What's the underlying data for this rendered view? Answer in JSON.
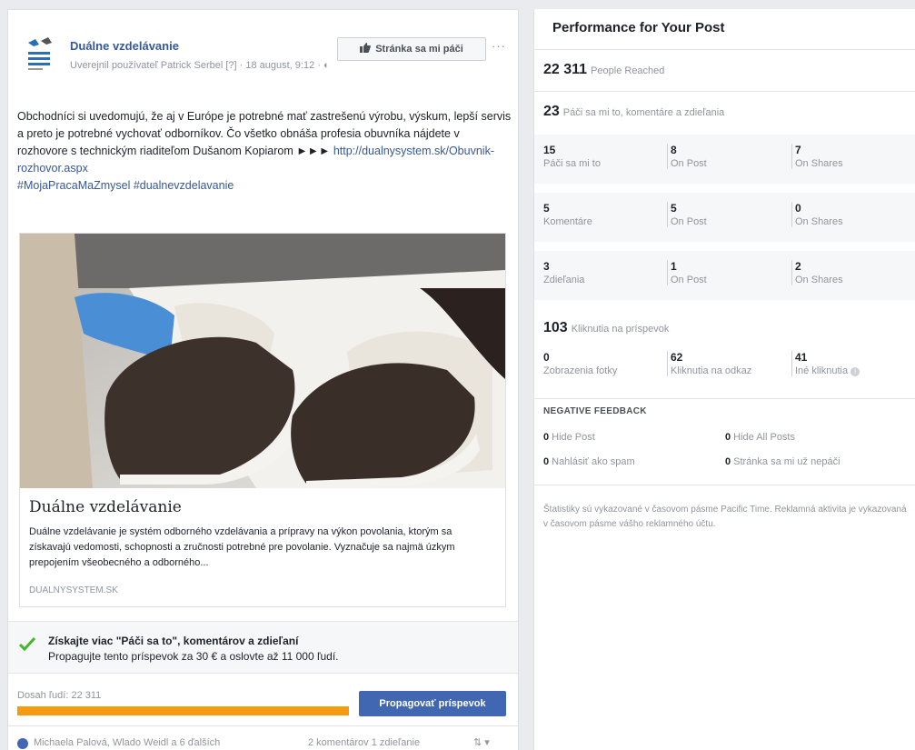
{
  "post": {
    "page_name": "Duálne vzdelávanie",
    "meta": "Uverejnil používateľ Patrick Serbel [?] · 18 august, 9:12 · ",
    "like_page_label": "Stránka sa mi páči",
    "more_label": "···",
    "text_main": "Obchodníci si uvedomujú, že aj v Európe je potrebné mať zastrešenú výrobu, výskum, lepší servis a preto je potrebné vychovať odborníkov. Čo všetko obnáša profesia obuvníka nájdete v rozhovore s technickým riaditeľom Dušanom Kopiarom ►►► ",
    "text_link": "http://dualnysystem.sk/Obuvnik-rozhovor.aspx",
    "hashtags": "#MojaPracaMaZmysel #dualnevzdelavanie",
    "attachment": {
      "title": "Duálne vzdelávanie",
      "description": "Duálne vzdelávanie je systém odborného vzdelávania a prípravy na výkon povolania, ktorým sa získavajú vedomosti, schopnosti a zručnosti potrebné pre povolanie. Vyznačuje sa najmä úzkym prepojením všeobecného a odborného...",
      "domain": "DUALNYSYSTEM.SK"
    },
    "promo": {
      "title": "Získajte viac \"Páči sa to\", komentárov a zdieľaní",
      "text": "Propagujte tento príspevok za 30 € a oslovte až 11 000 ľudí."
    },
    "reach": {
      "label": "Dosah ľudí: 22 311",
      "progress_fraction": 1.0,
      "bar_color": "#f39c12",
      "boost_label": "Propagovať príspevok"
    },
    "footer": {
      "names": "Michaela Palová, Wlado Weidl a 6 ďalších",
      "counts": "2 komentárov  1 zdieľanie",
      "sort": "⇅ ▾"
    }
  },
  "performance": {
    "title": "Performance for Your Post",
    "reached": {
      "value": "22 311",
      "label": "People Reached"
    },
    "engagement": {
      "value": "23",
      "label": "Páči sa mi to, komentáre a zdieľania"
    },
    "rows": [
      [
        {
          "value": "15",
          "label": "Páči sa mi to"
        },
        {
          "value": "8",
          "label": "On Post"
        },
        {
          "value": "7",
          "label": "On Shares"
        }
      ],
      [
        {
          "value": "5",
          "label": "Komentáre"
        },
        {
          "value": "5",
          "label": "On Post"
        },
        {
          "value": "0",
          "label": "On Shares"
        }
      ],
      [
        {
          "value": "3",
          "label": "Zdieľania"
        },
        {
          "value": "1",
          "label": "On Post"
        },
        {
          "value": "2",
          "label": "On Shares"
        }
      ]
    ],
    "clicks": {
      "value": "103",
      "label": "Kliknutia na príspevok"
    },
    "click_breakdown": [
      {
        "value": "0",
        "label": "Zobrazenia fotky"
      },
      {
        "value": "62",
        "label": "Kliknutia na odkaz"
      },
      {
        "value": "41",
        "label": "Iné kliknutia"
      }
    ],
    "negative_title": "NEGATIVE FEEDBACK",
    "negative": [
      {
        "value": "0",
        "label": "Hide Post"
      },
      {
        "value": "0",
        "label": "Hide All Posts"
      },
      {
        "value": "0",
        "label": "Nahlásiť ako spam"
      },
      {
        "value": "0",
        "label": "Stránka sa mi už nepáči"
      }
    ],
    "note": "Štatistiky sú vykazované v časovom pásme Pacific Time. Reklamná aktivita je vykazovaná v časovom pásme vášho reklamného účtu."
  },
  "colors": {
    "link": "#365899",
    "primary_button": "#4267b2",
    "reach_bar": "#f39c12",
    "check": "#42b72a"
  },
  "icons": [
    "page-logo-icon",
    "thumbs-up-icon",
    "globe-icon",
    "check-icon",
    "info-icon",
    "avatar-icon"
  ]
}
